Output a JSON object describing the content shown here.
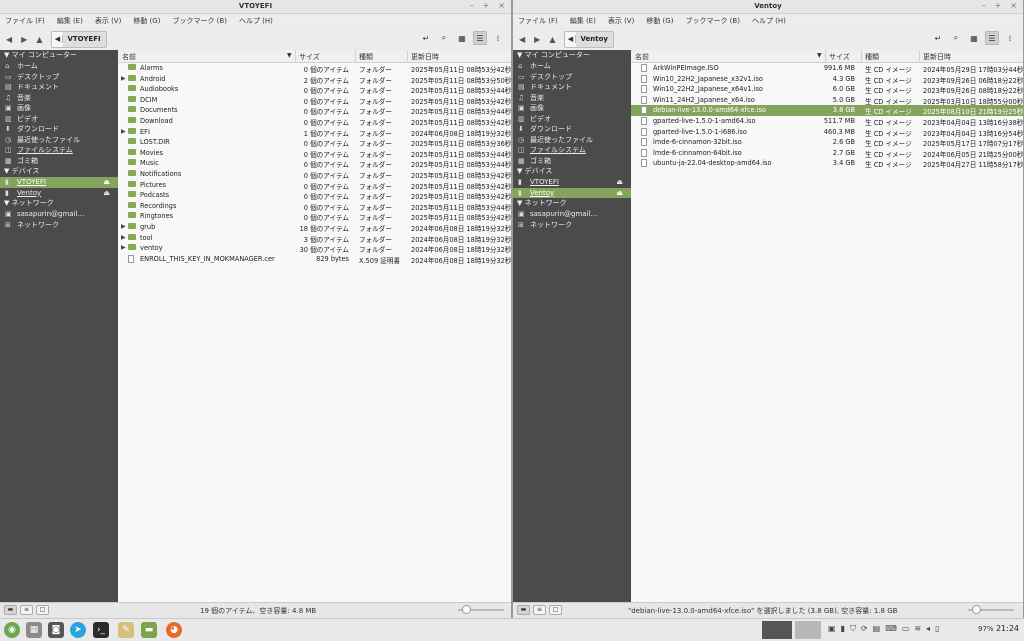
{
  "menu": [
    "ファイル (F)",
    "編集 (E)",
    "表示 (V)",
    "移動 (G)",
    "ブックマーク (B)",
    "ヘルプ (H)"
  ],
  "window_controls": [
    "–",
    "+",
    "×"
  ],
  "sidebar": {
    "heading_computer": "マイ コンピューター",
    "places": [
      {
        "icon": "home-icon",
        "glyph": "⌂",
        "label": "ホーム"
      },
      {
        "icon": "desktop-icon",
        "glyph": "▭",
        "label": "デスクトップ"
      },
      {
        "icon": "documents-icon",
        "glyph": "▤",
        "label": "ドキュメント"
      },
      {
        "icon": "music-icon",
        "glyph": "♫",
        "label": "音楽"
      },
      {
        "icon": "pictures-icon",
        "glyph": "▣",
        "label": "画像"
      },
      {
        "icon": "videos-icon",
        "glyph": "▥",
        "label": "ビデオ"
      },
      {
        "icon": "downloads-icon",
        "glyph": "⬇",
        "label": "ダウンロード"
      },
      {
        "icon": "recent-icon",
        "glyph": "◷",
        "label": "最近使ったファイル"
      },
      {
        "icon": "filesystem-icon",
        "glyph": "◫",
        "label": "ファイルシステム"
      },
      {
        "icon": "trash-icon",
        "glyph": "▦",
        "label": "ゴミ箱"
      }
    ],
    "heading_devices": "デバイス",
    "devices": [
      "VTOYEFI",
      "Ventoy"
    ],
    "heading_network": "ネットワーク",
    "network": [
      {
        "icon": "network-share-icon",
        "glyph": "▣",
        "label": "sasapurin@gmail…"
      },
      {
        "icon": "network-icon",
        "glyph": "⊞",
        "label": "ネットワーク"
      }
    ]
  },
  "columns": {
    "name": "名前",
    "size": "サイズ",
    "type": "種類",
    "modified": "更新日時"
  },
  "left": {
    "title": "VTOYEFI",
    "breadcrumb": "VTOYEFI",
    "selected_device": 0,
    "files": [
      {
        "name": "Alarms",
        "size": "0 個のアイテム",
        "type": "フォルダー",
        "date": "2025年05月11日 08時53分42秒",
        "kind": "folder",
        "expand": false
      },
      {
        "name": "Android",
        "size": "2 個のアイテム",
        "type": "フォルダー",
        "date": "2025年05月11日 08時53分50秒",
        "kind": "folder",
        "expand": true
      },
      {
        "name": "Audiobooks",
        "size": "0 個のアイテム",
        "type": "フォルダー",
        "date": "2025年05月11日 08時53分44秒",
        "kind": "folder",
        "expand": false
      },
      {
        "name": "DCIM",
        "size": "0 個のアイテム",
        "type": "フォルダー",
        "date": "2025年05月11日 08時53分42秒",
        "kind": "folder",
        "expand": false
      },
      {
        "name": "Documents",
        "size": "0 個のアイテム",
        "type": "フォルダー",
        "date": "2025年05月11日 08時53分44秒",
        "kind": "folder",
        "expand": false
      },
      {
        "name": "Download",
        "size": "0 個のアイテム",
        "type": "フォルダー",
        "date": "2025年05月11日 08時53分42秒",
        "kind": "folder",
        "expand": false
      },
      {
        "name": "EFI",
        "size": "1 個のアイテム",
        "type": "フォルダー",
        "date": "2024年06月08日 18時19分32秒",
        "kind": "folder",
        "expand": true
      },
      {
        "name": "LOST.DIR",
        "size": "0 個のアイテム",
        "type": "フォルダー",
        "date": "2025年05月11日 08時53分36秒",
        "kind": "folder",
        "expand": false
      },
      {
        "name": "Movies",
        "size": "0 個のアイテム",
        "type": "フォルダー",
        "date": "2025年05月11日 08時53分44秒",
        "kind": "folder",
        "expand": false
      },
      {
        "name": "Music",
        "size": "0 個のアイテム",
        "type": "フォルダー",
        "date": "2025年05月11日 08時53分44秒",
        "kind": "folder",
        "expand": false
      },
      {
        "name": "Notifications",
        "size": "0 個のアイテム",
        "type": "フォルダー",
        "date": "2025年05月11日 08時53分42秒",
        "kind": "folder",
        "expand": false
      },
      {
        "name": "Pictures",
        "size": "0 個のアイテム",
        "type": "フォルダー",
        "date": "2025年05月11日 08時53分42秒",
        "kind": "folder",
        "expand": false
      },
      {
        "name": "Podcasts",
        "size": "0 個のアイテム",
        "type": "フォルダー",
        "date": "2025年05月11日 08時53分42秒",
        "kind": "folder",
        "expand": false
      },
      {
        "name": "Recordings",
        "size": "0 個のアイテム",
        "type": "フォルダー",
        "date": "2025年05月11日 08時53分44秒",
        "kind": "folder",
        "expand": false
      },
      {
        "name": "Ringtones",
        "size": "0 個のアイテム",
        "type": "フォルダー",
        "date": "2025年05月11日 08時53分42秒",
        "kind": "folder",
        "expand": false
      },
      {
        "name": "grub",
        "size": "18 個のアイテム",
        "type": "フォルダー",
        "date": "2024年06月08日 18時19分32秒",
        "kind": "folder",
        "expand": true
      },
      {
        "name": "tool",
        "size": "3 個のアイテム",
        "type": "フォルダー",
        "date": "2024年06月08日 18時19分32秒",
        "kind": "folder",
        "expand": true
      },
      {
        "name": "ventoy",
        "size": "30 個のアイテム",
        "type": "フォルダー",
        "date": "2024年06月08日 18時19分32秒",
        "kind": "folder",
        "expand": true
      },
      {
        "name": "ENROLL_THIS_KEY_IN_MOKMANAGER.cer",
        "size": "829 bytes",
        "type": "X.509 証明書",
        "date": "2024年06月08日 18時19分32秒",
        "kind": "file",
        "expand": false
      }
    ],
    "status": "19 個のアイテム、空き容量: 4.8 MB",
    "zoom_level": 0.1
  },
  "right": {
    "title": "Ventoy",
    "breadcrumb": "Ventoy",
    "selected_device": 1,
    "selected_row": 4,
    "files": [
      {
        "name": "ArkWinPEImage.ISO",
        "size": "991.6 MB",
        "type": "生 CD イメージ",
        "date": "2024年05月29日 17時03分44秒",
        "kind": "file",
        "expand": false
      },
      {
        "name": "Win10_22H2_Japanese_x32v1.iso",
        "size": "4.3 GB",
        "type": "生 CD イメージ",
        "date": "2023年09月26日 06時18分22秒",
        "kind": "file",
        "expand": false
      },
      {
        "name": "Win10_22H2_Japanese_x64v1.iso",
        "size": "6.0 GB",
        "type": "生 CD イメージ",
        "date": "2023年09月26日 08時18分22秒",
        "kind": "file",
        "expand": false
      },
      {
        "name": "Win11_24H2_Japanese_x64.iso",
        "size": "5.0 GB",
        "type": "生 CD イメージ",
        "date": "2025年03月10日 18時55分00秒",
        "kind": "file",
        "expand": false
      },
      {
        "name": "debian-live-13.0.0-amd64-xfce.iso",
        "size": "3.8 GB",
        "type": "生 CD イメージ",
        "date": "2025年08月10日 21時19分25秒",
        "kind": "file",
        "expand": false
      },
      {
        "name": "gparted-live-1.5.0-1-amd64.iso",
        "size": "511.7 MB",
        "type": "生 CD イメージ",
        "date": "2023年04月04日 13時16分38秒",
        "kind": "file",
        "expand": false
      },
      {
        "name": "gparted-live-1.5.0-1-i686.iso",
        "size": "460.3 MB",
        "type": "生 CD イメージ",
        "date": "2023年04月04日 13時16分54秒",
        "kind": "file",
        "expand": false
      },
      {
        "name": "lmde-6-cinnamon-32bit.iso",
        "size": "2.6 GB",
        "type": "生 CD イメージ",
        "date": "2025年05月17日 17時07分17秒",
        "kind": "file",
        "expand": false
      },
      {
        "name": "lmde-6-cinnamon-64bit.iso",
        "size": "2.7 GB",
        "type": "生 CD イメージ",
        "date": "2024年06月05日 21時25分00秒",
        "kind": "file",
        "expand": false
      },
      {
        "name": "ubuntu-ja-22.04-desktop-amd64.iso",
        "size": "3.4 GB",
        "type": "生 CD イメージ",
        "date": "2025年04月27日 11時58分17秒",
        "kind": "file",
        "expand": false
      }
    ],
    "status": "\"debian-live-13.0.0-amd64-xfce.iso\" を選択しました (3.8 GB), 空き容量: 1.8 GB",
    "zoom_level": 0.1
  },
  "taskbar": {
    "apps": [
      "mint-menu-icon",
      "calculator-icon",
      "screenshot-icon",
      "telegram-icon",
      "terminal-icon",
      "text-editor-icon",
      "files-icon",
      "firefox-icon"
    ],
    "clock": "21:24",
    "battery": "97%"
  },
  "colors": {
    "selection": "#84a45e",
    "sidebar": "#4b4b4b",
    "folder": "#86a954"
  }
}
